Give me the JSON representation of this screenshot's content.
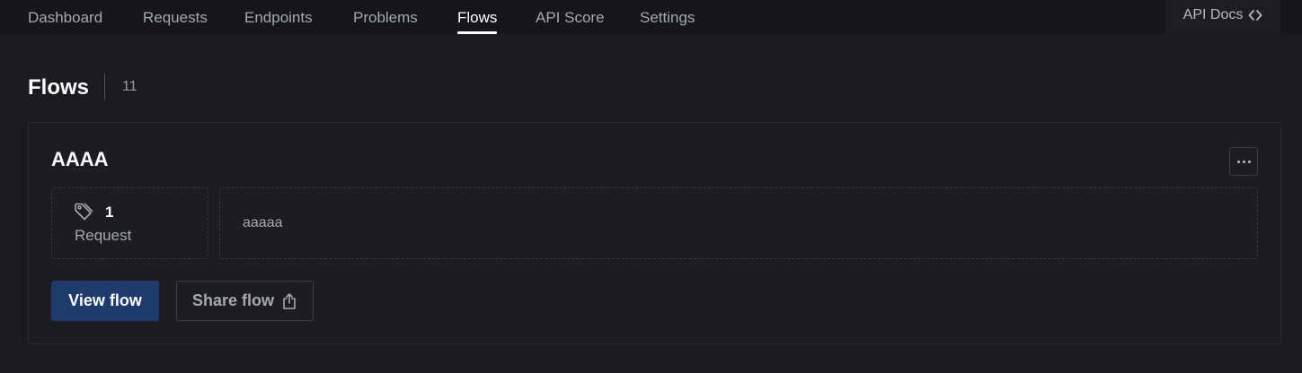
{
  "nav": {
    "tabs": [
      {
        "label": "Dashboard"
      },
      {
        "label": "Requests"
      },
      {
        "label": "Endpoints"
      },
      {
        "label": "Problems"
      },
      {
        "label": "Flows",
        "active": true
      },
      {
        "label": "API Score"
      },
      {
        "label": "Settings"
      }
    ],
    "api_docs_label": "API Docs",
    "api_docs_icon": "code-brackets-icon"
  },
  "page": {
    "title": "Flows",
    "count": "11"
  },
  "flow_card": {
    "title": "AAAA",
    "more_icon": "more-horizontal-icon",
    "stat_icon": "tag-icon",
    "stat_value": "1",
    "stat_label": "Request",
    "description": "aaaaa",
    "view_button": "View flow",
    "share_button": "Share flow",
    "share_icon": "share-upload-icon"
  },
  "colors": {
    "background": "#1b1a23",
    "nav_background": "#16151c",
    "card_background": "#1d1c25",
    "primary_button": "#1f3a6d"
  }
}
